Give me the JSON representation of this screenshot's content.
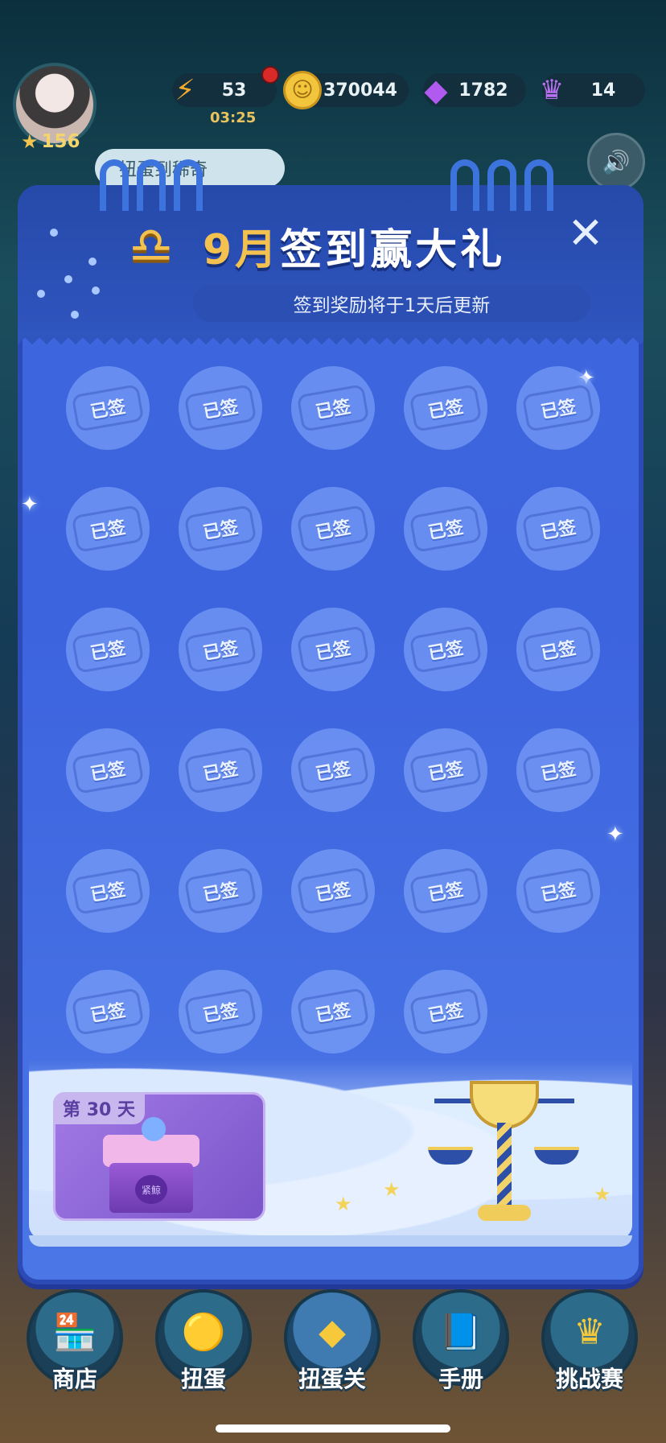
{
  "status": {
    "level": "156",
    "energy": "53",
    "energy_timer": "03:25",
    "coins": "370044",
    "gems": "1782",
    "crowns": "14",
    "bubble_text": "扭蛋到稀奇"
  },
  "panel": {
    "title_month": "9月",
    "title_text": "签到赢大礼",
    "subtitle": "签到奖励将于1天后更新",
    "close_label": "✕",
    "signed_label": "已签",
    "signed_days": 29,
    "reward_day_label": "第 30 天",
    "reward_emblem": "紧鲸"
  },
  "nav": [
    {
      "label": "商店",
      "icon": "shop-icon"
    },
    {
      "label": "扭蛋",
      "icon": "gashapon-icon"
    },
    {
      "label": "扭蛋关",
      "icon": "gashapon-level-icon"
    },
    {
      "label": "手册",
      "icon": "handbook-icon"
    },
    {
      "label": "挑战赛",
      "icon": "challenge-icon"
    }
  ],
  "colors": {
    "panel_blue": "#3d64df",
    "gold": "#f3c14f",
    "coin": "#f2c53d",
    "gem": "#9b4fe0"
  }
}
